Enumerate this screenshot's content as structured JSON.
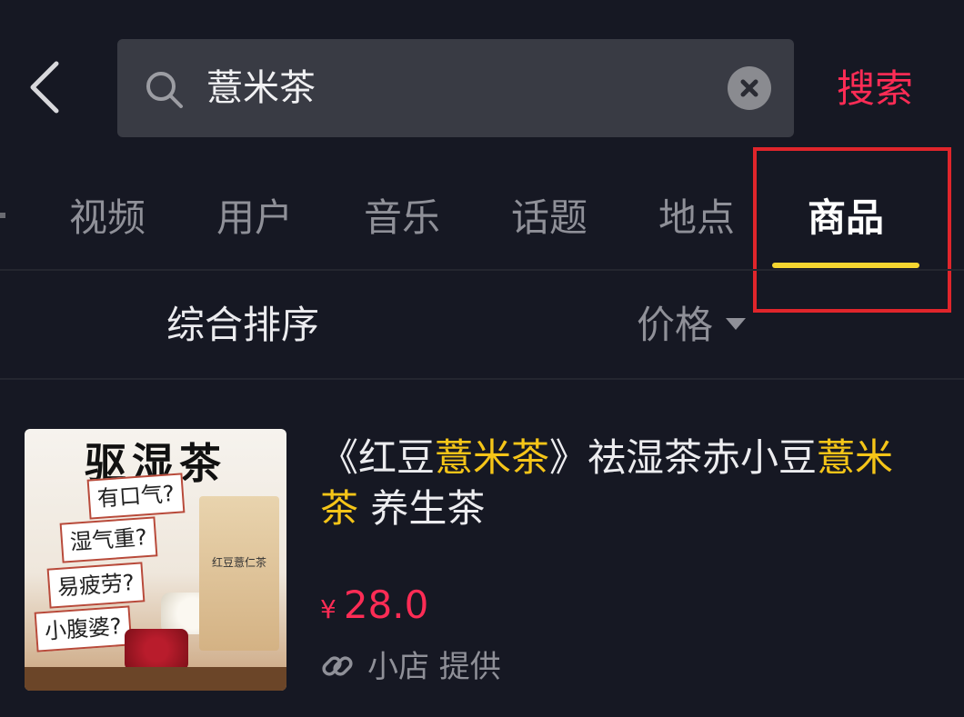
{
  "search": {
    "query": "薏米茶",
    "submit_label": "搜索"
  },
  "tabs": [
    {
      "label": "视频",
      "active": false
    },
    {
      "label": "用户",
      "active": false
    },
    {
      "label": "音乐",
      "active": false
    },
    {
      "label": "话题",
      "active": false
    },
    {
      "label": "地点",
      "active": false
    },
    {
      "label": "商品",
      "active": true
    }
  ],
  "sort": {
    "default_label": "综合排序",
    "price_label": "价格"
  },
  "product": {
    "title_parts": [
      {
        "text": "《红豆",
        "highlight": false
      },
      {
        "text": "薏米茶",
        "highlight": true
      },
      {
        "text": "》祛湿茶赤小豆",
        "highlight": false
      },
      {
        "text": "薏米茶",
        "highlight": true
      },
      {
        "text": " 养生茶",
        "highlight": false
      }
    ],
    "currency_symbol": "¥",
    "price": "28.0",
    "shop_label": "小店 提供",
    "image": {
      "title": "驱湿茶",
      "tags": [
        "有口气?",
        "湿气重?",
        "易疲劳?",
        "小腹婆?"
      ],
      "package_label": "红豆薏仁茶"
    }
  },
  "colors": {
    "background": "#161823",
    "accent_red": "#fe2c55",
    "keyword_highlight": "#f5c518",
    "tab_underline": "#f5d530",
    "annotation_box": "#e0252b"
  }
}
